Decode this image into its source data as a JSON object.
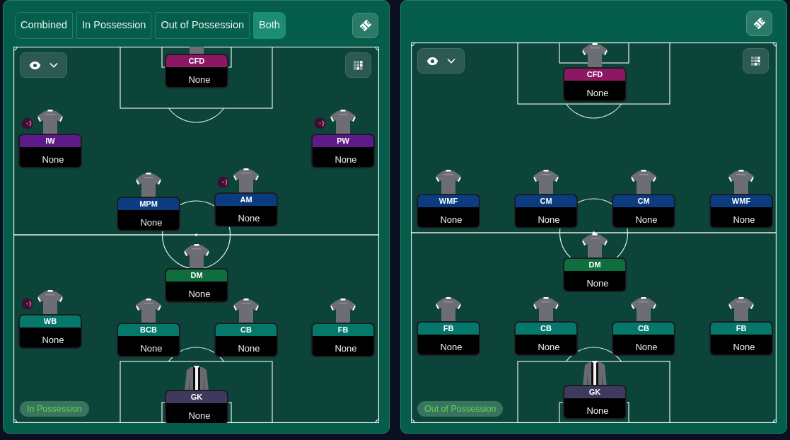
{
  "panels": [
    {
      "tabs": [
        {
          "label": "Combined",
          "selected": false
        },
        {
          "label": "In Possession",
          "selected": false
        },
        {
          "label": "Out of Possession",
          "selected": false
        },
        {
          "label": "Both",
          "selected": true
        }
      ],
      "phase_label": "In Possession",
      "players": [
        {
          "position": "CFD",
          "name": "None",
          "color": "#8c1762",
          "kind": "outfield",
          "indicator": false
        },
        {
          "position": "IW",
          "name": "None",
          "color": "#5f1a8a",
          "kind": "outfield",
          "indicator": true
        },
        {
          "position": "PW",
          "name": "None",
          "color": "#5f1a8a",
          "kind": "outfield",
          "indicator": true
        },
        {
          "position": "MPM",
          "name": "None",
          "color": "#0b3c80",
          "kind": "outfield",
          "indicator": false
        },
        {
          "position": "AM",
          "name": "None",
          "color": "#0b3c80",
          "kind": "outfield",
          "indicator": true
        },
        {
          "position": "DM",
          "name": "None",
          "color": "#0f6e3d",
          "kind": "outfield",
          "indicator": false
        },
        {
          "position": "WB",
          "name": "None",
          "color": "#04786b",
          "kind": "outfield",
          "indicator": true
        },
        {
          "position": "BCB",
          "name": "None",
          "color": "#04786b",
          "kind": "outfield",
          "indicator": false
        },
        {
          "position": "CB",
          "name": "None",
          "color": "#04786b",
          "kind": "outfield",
          "indicator": false
        },
        {
          "position": "FB",
          "name": "None",
          "color": "#04786b",
          "kind": "outfield",
          "indicator": false
        },
        {
          "position": "GK",
          "name": "None",
          "color": "#3e3a5e",
          "kind": "goalkeeper",
          "indicator": false
        }
      ]
    },
    {
      "phase_label": "Out of Possession",
      "players": [
        {
          "position": "CFD",
          "name": "None",
          "color": "#8c1762",
          "kind": "outfield",
          "indicator": false
        },
        {
          "position": "WMF",
          "name": "None",
          "color": "#0b3c80",
          "kind": "outfield",
          "indicator": false
        },
        {
          "position": "CM",
          "name": "None",
          "color": "#0b3c80",
          "kind": "outfield",
          "indicator": false
        },
        {
          "position": "CM",
          "name": "None",
          "color": "#0b3c80",
          "kind": "outfield",
          "indicator": false
        },
        {
          "position": "WMF",
          "name": "None",
          "color": "#0b3c80",
          "kind": "outfield",
          "indicator": false
        },
        {
          "position": "DM",
          "name": "None",
          "color": "#0f6e3d",
          "kind": "outfield",
          "indicator": false
        },
        {
          "position": "FB",
          "name": "None",
          "color": "#04786b",
          "kind": "outfield",
          "indicator": false
        },
        {
          "position": "CB",
          "name": "None",
          "color": "#04786b",
          "kind": "outfield",
          "indicator": false
        },
        {
          "position": "CB",
          "name": "None",
          "color": "#04786b",
          "kind": "outfield",
          "indicator": false
        },
        {
          "position": "FB",
          "name": "None",
          "color": "#04786b",
          "kind": "outfield",
          "indicator": false
        },
        {
          "position": "GK",
          "name": "None",
          "color": "#3e3a5e",
          "kind": "goalkeeper",
          "indicator": false
        }
      ]
    }
  ]
}
